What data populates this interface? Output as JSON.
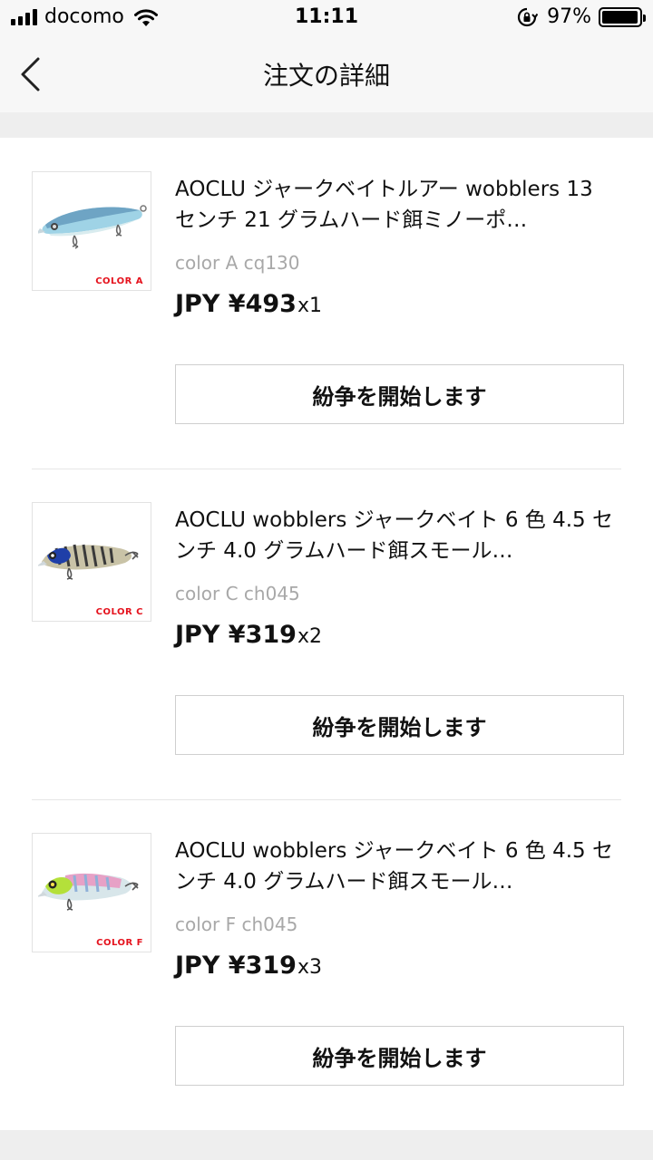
{
  "status_bar": {
    "carrier": "docomo",
    "time": "11:11",
    "battery_percent": "97%",
    "battery_level": 0.97,
    "icons": [
      "signal-icon",
      "wifi-icon",
      "rotation-lock-icon",
      "battery-icon"
    ]
  },
  "nav": {
    "title": "注文の詳細",
    "back_icon": "chevron-left-icon"
  },
  "items": [
    {
      "title": "AOCLU ジャークベイトルアー wobblers 13 センチ 21 グラムハード餌ミノーポ…",
      "variant": "color A cq130",
      "price": "JPY ¥493",
      "qty": "x1",
      "image_label": "COLOR A",
      "dispute_label": "紛争を開始します"
    },
    {
      "title": "AOCLU wobblers ジャークベイト 6 色 4.5 センチ 4.0 グラムハード餌スモール…",
      "variant": "color C ch045",
      "price": "JPY ¥319",
      "qty": "x2",
      "image_label": "COLOR C",
      "dispute_label": "紛争を開始します"
    },
    {
      "title": "AOCLU wobblers ジャークベイト 6 色 4.5 センチ 4.0 グラムハード餌スモール…",
      "variant": "color F ch045",
      "price": "JPY ¥319",
      "qty": "x3",
      "image_label": "COLOR F",
      "dispute_label": "紛争を開始します"
    }
  ],
  "colors": {
    "accent_red": "#e5121d",
    "muted_text": "#a8a8a8",
    "bar_bg": "#f7f7f7"
  }
}
